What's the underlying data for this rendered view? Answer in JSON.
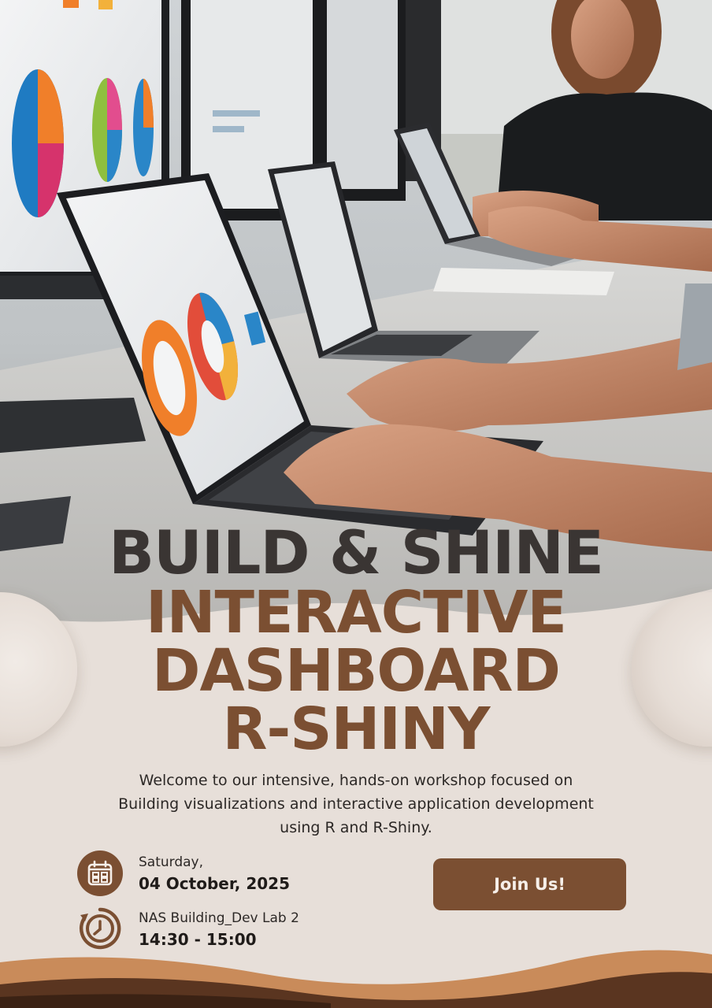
{
  "poster": {
    "headline": "BUILD & SHINE",
    "title_lines": [
      "INTERACTIVE",
      "DASHBOARD",
      "R-SHINY"
    ],
    "intro": "Welcome to our intensive, hands-on workshop focused on Building visualizations and interactive application development using R and R-Shiny.",
    "event": {
      "day": "Saturday,",
      "date": "04 October, 2025",
      "location": "NAS Building_Dev Lab 2",
      "time": "14:30 - 15:00"
    },
    "cta_label": "Join Us!",
    "icons": [
      "calendar-icon",
      "clock-icon"
    ]
  },
  "colors": {
    "brand_brown": "#7b4f32",
    "dark_text": "#3a3533",
    "background": "#e7dfd9",
    "wave_light": "#c98b5a",
    "wave_dark": "#5a3520"
  }
}
